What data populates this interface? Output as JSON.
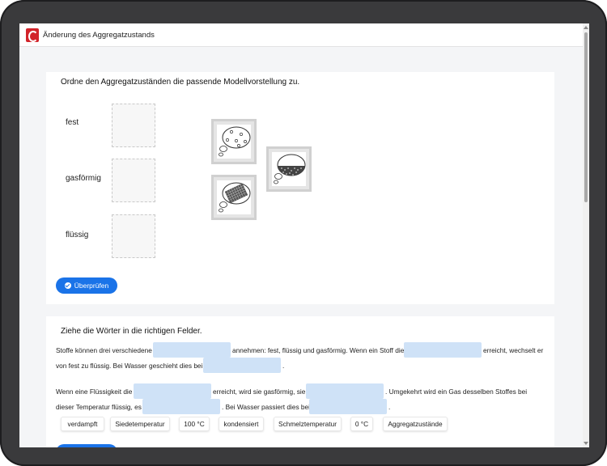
{
  "app": {
    "title": "Änderung des Aggregatzustands",
    "logo_icon": "C-logo-icon",
    "brand_color": "#d2232a"
  },
  "task1": {
    "instruction": "Ordne den Aggregatzuständen die passende Modellvorstellung zu.",
    "states": [
      "fest",
      "gasförmig",
      "flüssig"
    ],
    "model_tiles": [
      "gas-model-icon",
      "liquid-model-icon",
      "solid-model-icon"
    ],
    "check_button": "Überprüfen"
  },
  "task2": {
    "instruction": "Ziehe die Wörter in die richtigen Felder.",
    "p1_a": "Stoffe können drei verschiedene",
    "p1_b": "annehmen: fest, flüssig und gasförmig. Wenn ein Stoff die",
    "p1_c": "erreicht, wechselt er",
    "p1_d": "von fest zu flüssig. Bei Wasser geschieht dies bei",
    "p1_e": ".",
    "p2_a": "Wenn eine Flüssigkeit die",
    "p2_b": "erreicht, wird sie gasförmig, sie",
    "p2_c": ". Umgekehrt wird ein Gas desselben Stoffes bei",
    "p2_d": "dieser Temperatur flüssig, es",
    "p2_e": ". Bei Wasser passiert dies bei",
    "p2_f": ".",
    "words": [
      "verdampft",
      "Siedetemperatur",
      "100 °C",
      "kondensiert",
      "Schmelztemperatur",
      "0 °C",
      "Aggregatzustände"
    ]
  },
  "colors": {
    "accent": "#1a73e8",
    "gap_fill": "#cfe2f7"
  }
}
